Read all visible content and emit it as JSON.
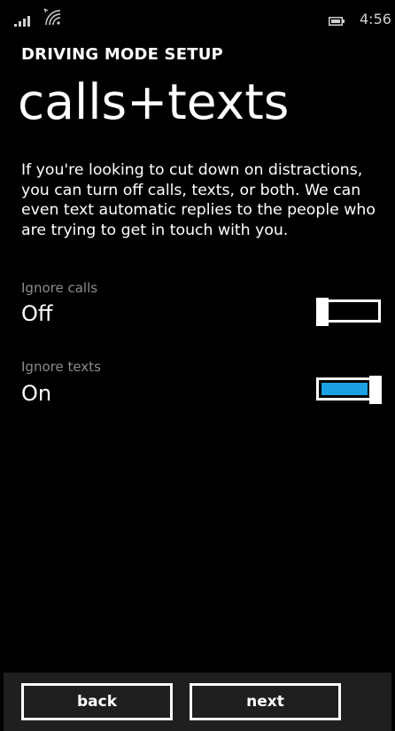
{
  "status_bar": {
    "time": "4:56",
    "icons": [
      "signal-strength-icon",
      "wifi-icon",
      "battery-icon"
    ]
  },
  "header": {
    "app_title": "DRIVING MODE SETUP",
    "page_title": "calls+texts"
  },
  "description": "If you're looking to cut down on distractions, you can turn off calls, texts, or both. We can even text automatic replies to the people who are trying to get in touch with you.",
  "settings": [
    {
      "label": "Ignore calls",
      "value": "Off",
      "on": false
    },
    {
      "label": "Ignore texts",
      "value": "On",
      "on": true
    }
  ],
  "app_bar": {
    "back_label": "back",
    "next_label": "next"
  },
  "colors": {
    "accent": "#1ba1e2",
    "background": "#000000",
    "label": "#8c8c8c",
    "app_bar": "#1f1f1f"
  }
}
